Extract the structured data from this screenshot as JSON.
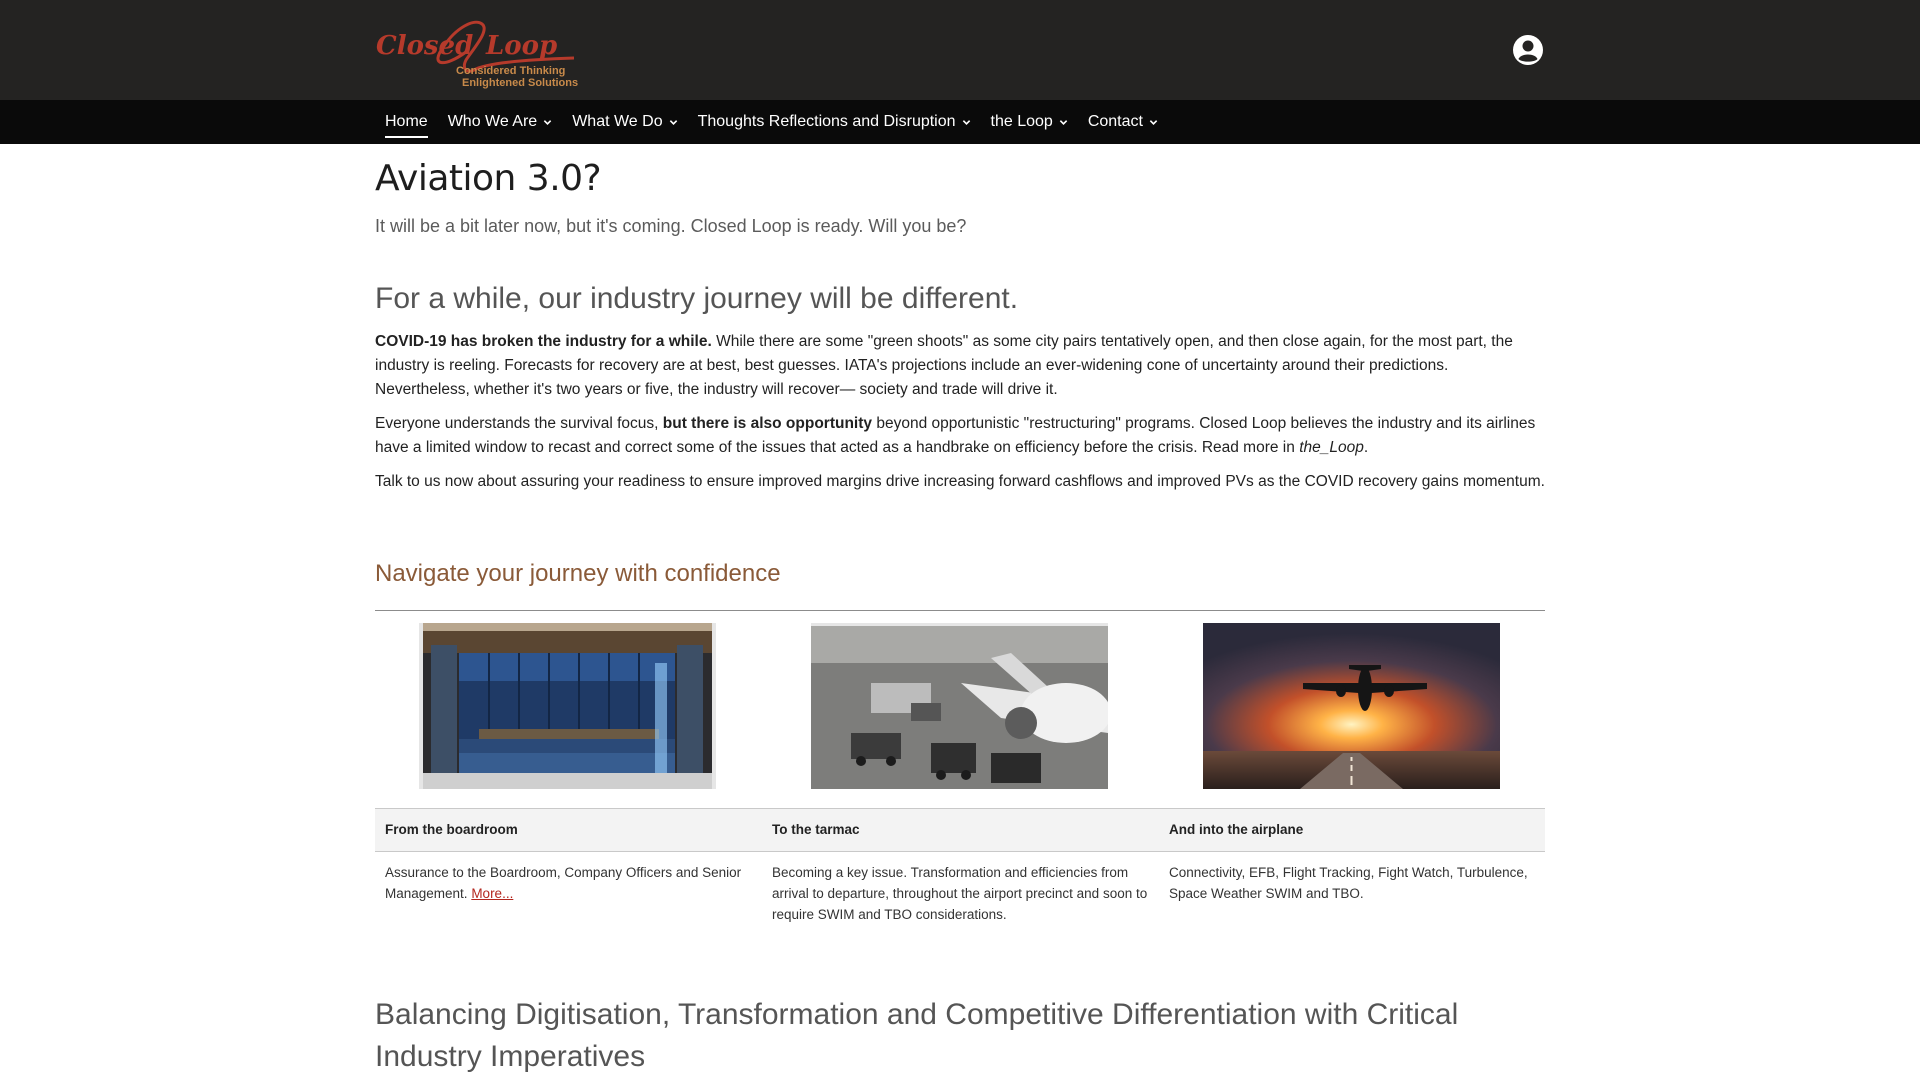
{
  "brand": {
    "logo_text": "Closed Loop",
    "tagline_1": "Considered Thinking",
    "tagline_2": "Enlightened Solutions",
    "colors": {
      "logo_red": "#b63a2b",
      "tagline": "#c88a4a",
      "header_bg": "#242322",
      "nav_bg": "#0a0a0a",
      "accent_brown": "#8a5a38",
      "link_red": "#b3261e"
    }
  },
  "header": {
    "user_icon": "user-circle-icon"
  },
  "nav": {
    "items": [
      {
        "label": "Home",
        "active": true,
        "has_dropdown": false
      },
      {
        "label": "Who We Are",
        "has_dropdown": true
      },
      {
        "label": "What We Do",
        "has_dropdown": true
      },
      {
        "label": "Thoughts Reflections and Disruption",
        "has_dropdown": true
      },
      {
        "label": "the Loop",
        "has_dropdown": true
      },
      {
        "label": "Contact",
        "has_dropdown": true
      }
    ]
  },
  "main": {
    "title": "Aviation 3.0?",
    "subtitle": "It will be a bit later now, but it's coming. Closed Loop is ready. Will you be?",
    "section_heading": "For a while, our industry journey will be different.",
    "p1_bold": "COVID-19 has broken the industry for a while.",
    "p1_rest": " While there are some \"green shoots\" as some city pairs tentatively open, and then close again, for the most part, the industry is reeling. Forecasts for recovery are at best, best guesses. IATA's projections include an ever-widening cone of uncertainty around their predictions. Nevertheless, whether it's two years or five, the industry will recover— society and trade will drive it.",
    "p2_start": "Everyone understands the survival focus, ",
    "p2_bold": "but there is also opportunity",
    "p2_mid": " beyond opportunistic \"restructuring\" programs. Closed Loop believes the industry and its airlines have a limited window to recast and correct some of the issues that acted as a handbrake on efficiency before the crisis. Read more in ",
    "p2_italic": "the_Loop",
    "p2_end": ".",
    "p3": "Talk to us now about assuring your readiness to ensure improved margins drive increasing forward cashflows and improved PVs as the COVID recovery gains momentum.",
    "navigate_heading": "Navigate your journey with confidence",
    "columns": [
      {
        "caption": "From the boardroom",
        "text": "Assurance to the Boardroom, Company Officers and Senior Management. ",
        "link": "More..."
      },
      {
        "caption": "To the tarmac",
        "text": "Becoming a key issue. Transformation and efficiencies from arrival to departure, throughout the airport precinct and soon to require SWIM and TBO considerations."
      },
      {
        "caption": "And into the airplane",
        "text": "Connectivity, EFB, Flight Tracking, Fight Watch, Turbulence, Space Weather SWIM and TBO."
      }
    ],
    "bottom_heading": "Balancing Digitisation, Transformation and Competitive Differentiation with Critical Industry Imperatives"
  }
}
